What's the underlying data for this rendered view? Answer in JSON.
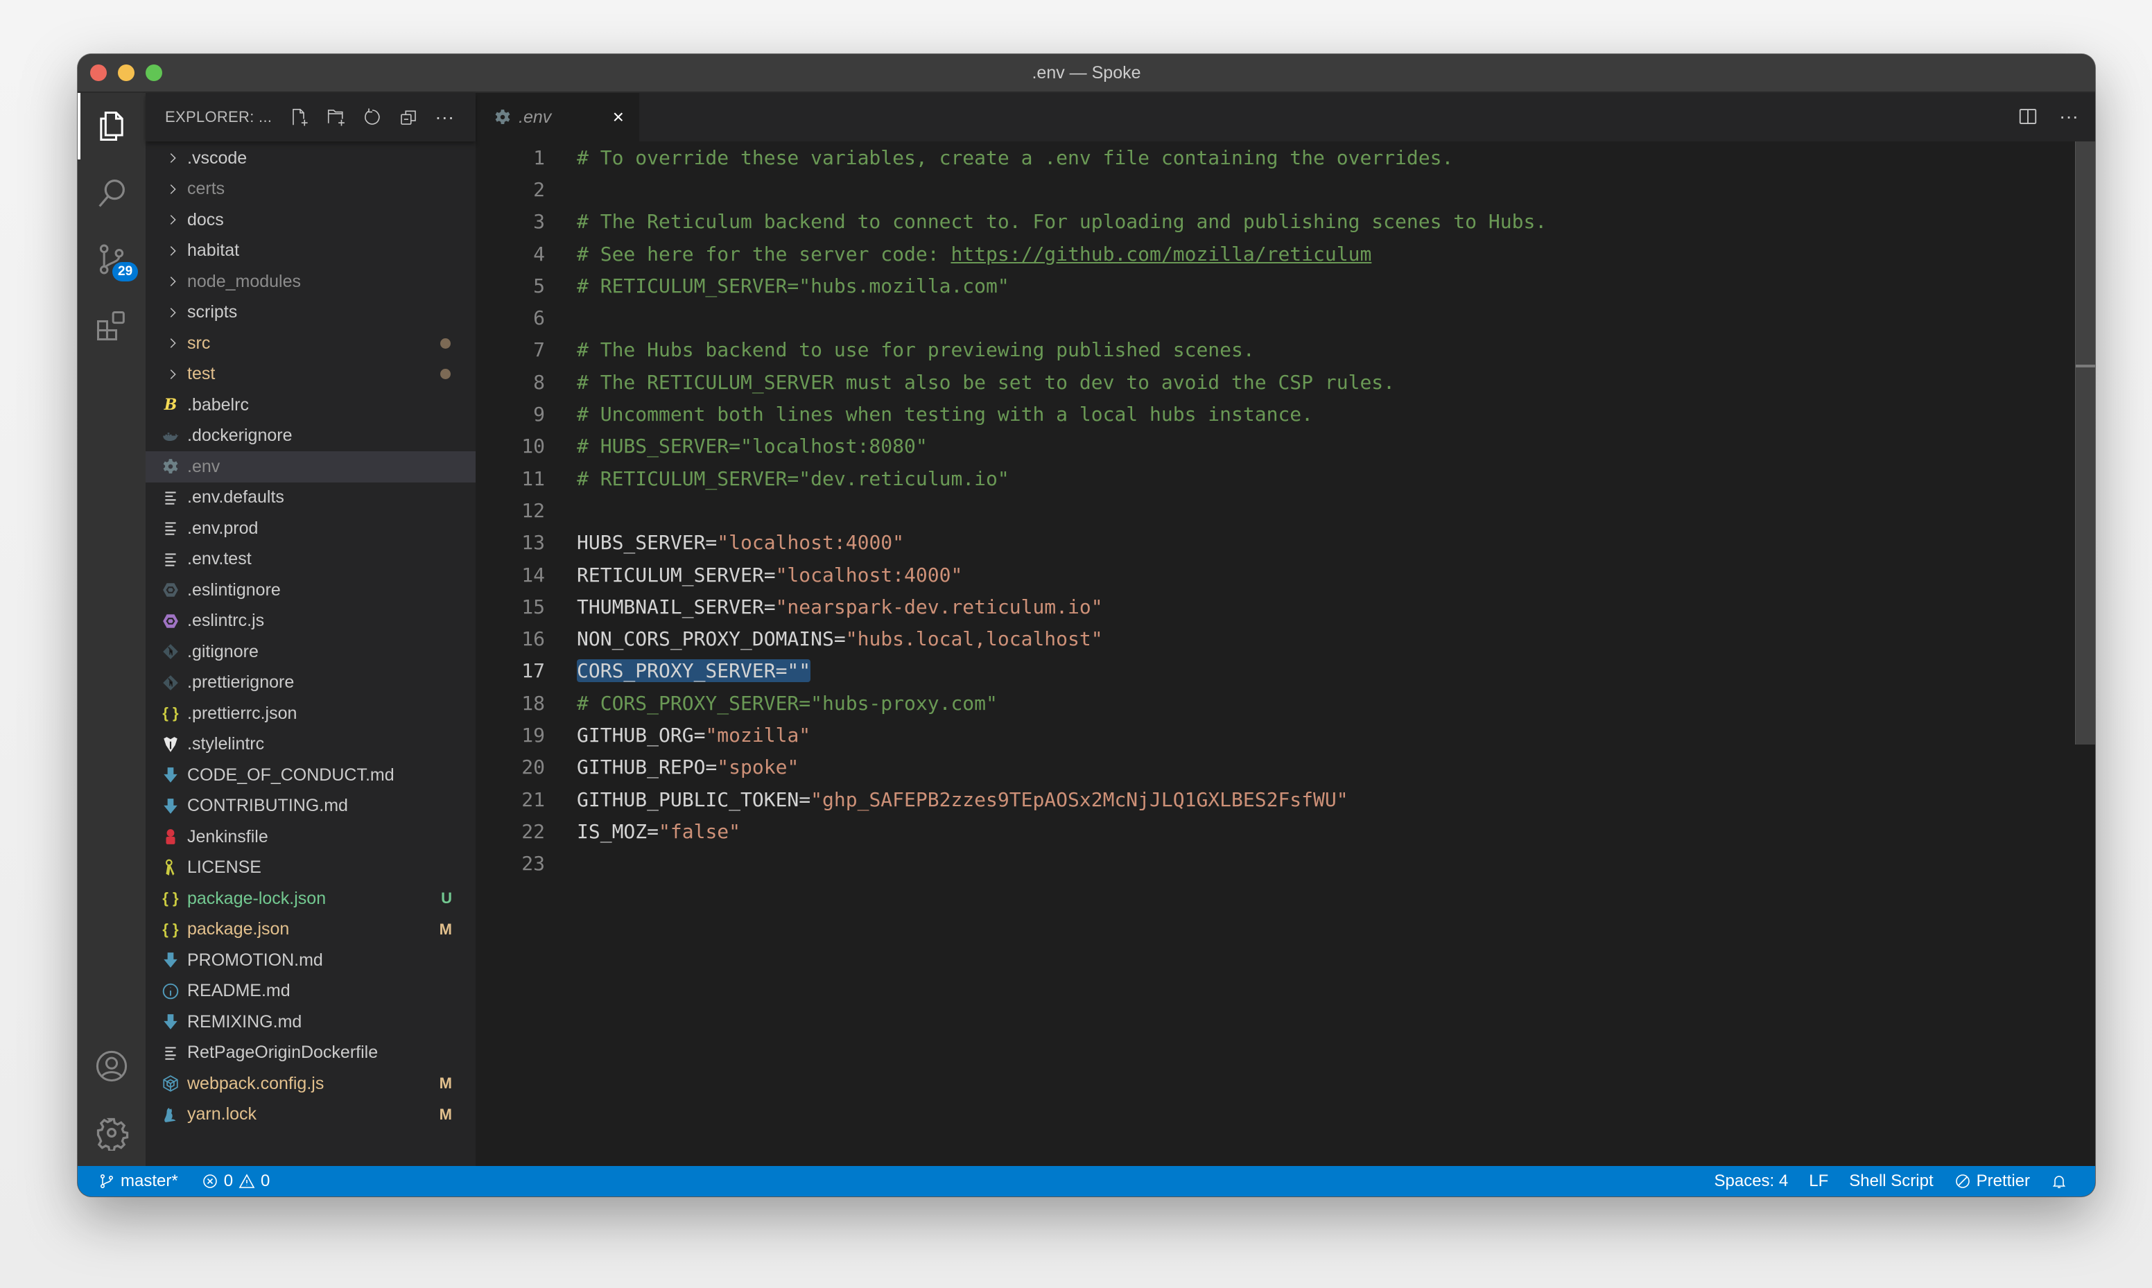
{
  "window": {
    "title": ".env — Spoke"
  },
  "activity_bar": {
    "items": [
      {
        "name": "explorer",
        "icon": "files-icon",
        "active": true
      },
      {
        "name": "search",
        "icon": "search-icon"
      },
      {
        "name": "source-control",
        "icon": "source-control-icon",
        "badge": "29"
      },
      {
        "name": "extensions",
        "icon": "extensions-icon"
      }
    ],
    "bottom": [
      {
        "name": "accounts",
        "icon": "account-icon"
      },
      {
        "name": "manage",
        "icon": "gear-icon"
      }
    ]
  },
  "sidebar": {
    "title": "EXPLORER: ...",
    "actions": [
      "new-file",
      "new-folder",
      "refresh",
      "collapse-all",
      "more"
    ],
    "items": [
      {
        "label": ".vscode",
        "type": "folder"
      },
      {
        "label": "certs",
        "type": "folder",
        "dim": true
      },
      {
        "label": "docs",
        "type": "folder"
      },
      {
        "label": "habitat",
        "type": "folder"
      },
      {
        "label": "node_modules",
        "type": "folder",
        "dim": true
      },
      {
        "label": "scripts",
        "type": "folder"
      },
      {
        "label": "src",
        "type": "folder",
        "status": "modified-dot"
      },
      {
        "label": "test",
        "type": "folder",
        "status": "modified-dot"
      },
      {
        "label": ".babelrc",
        "type": "file",
        "icon": "babel-icon"
      },
      {
        "label": ".dockerignore",
        "type": "file",
        "icon": "docker-icon"
      },
      {
        "label": ".env",
        "type": "file",
        "icon": "gear-file-icon",
        "selected": true,
        "dim": true
      },
      {
        "label": ".env.defaults",
        "type": "file",
        "icon": "text-lines-icon"
      },
      {
        "label": ".env.prod",
        "type": "file",
        "icon": "text-lines-icon"
      },
      {
        "label": ".env.test",
        "type": "file",
        "icon": "text-lines-icon"
      },
      {
        "label": ".eslintignore",
        "type": "file",
        "icon": "eslint-ignore-icon"
      },
      {
        "label": ".eslintrc.js",
        "type": "file",
        "icon": "eslint-icon"
      },
      {
        "label": ".gitignore",
        "type": "file",
        "icon": "git-icon"
      },
      {
        "label": ".prettierignore",
        "type": "file",
        "icon": "git-icon"
      },
      {
        "label": ".prettierrc.json",
        "type": "file",
        "icon": "json-icon"
      },
      {
        "label": ".stylelintrc",
        "type": "file",
        "icon": "stylelint-icon"
      },
      {
        "label": "CODE_OF_CONDUCT.md",
        "type": "file",
        "icon": "markdown-icon"
      },
      {
        "label": "CONTRIBUTING.md",
        "type": "file",
        "icon": "markdown-icon"
      },
      {
        "label": "Jenkinsfile",
        "type": "file",
        "icon": "jenkins-icon"
      },
      {
        "label": "LICENSE",
        "type": "file",
        "icon": "license-icon"
      },
      {
        "label": "package-lock.json",
        "type": "file",
        "icon": "json-icon",
        "git": "U"
      },
      {
        "label": "package.json",
        "type": "file",
        "icon": "json-icon",
        "git": "M"
      },
      {
        "label": "PROMOTION.md",
        "type": "file",
        "icon": "markdown-icon"
      },
      {
        "label": "README.md",
        "type": "file",
        "icon": "info-icon"
      },
      {
        "label": "REMIXING.md",
        "type": "file",
        "icon": "markdown-icon"
      },
      {
        "label": "RetPageOriginDockerfile",
        "type": "file",
        "icon": "text-lines-icon"
      },
      {
        "label": "webpack.config.js",
        "type": "file",
        "icon": "webpack-icon",
        "git": "M"
      },
      {
        "label": "yarn.lock",
        "type": "file",
        "icon": "yarn-icon",
        "git": "M"
      }
    ]
  },
  "editor": {
    "tab": {
      "label": ".env",
      "icon": "gear-file-icon",
      "close": "×"
    },
    "actions": [
      "split-editor",
      "more"
    ],
    "current_line": 17,
    "lines": [
      {
        "n": "1",
        "parts": [
          {
            "t": "# To override these variables, create a .env file containing the overrides.",
            "c": "cm"
          }
        ]
      },
      {
        "n": "2",
        "parts": []
      },
      {
        "n": "3",
        "parts": [
          {
            "t": "# The Reticulum backend to connect to. For uploading and publishing scenes to Hubs.",
            "c": "cm"
          }
        ]
      },
      {
        "n": "4",
        "parts": [
          {
            "t": "# See here for the server code: ",
            "c": "cm"
          },
          {
            "t": "https://github.com/mozilla/reticulum",
            "c": "cm link"
          }
        ]
      },
      {
        "n": "5",
        "parts": [
          {
            "t": "# RETICULUM_SERVER=\"hubs.mozilla.com\"",
            "c": "cm"
          }
        ]
      },
      {
        "n": "6",
        "parts": []
      },
      {
        "n": "7",
        "parts": [
          {
            "t": "# The Hubs backend to use for previewing published scenes.",
            "c": "cm"
          }
        ]
      },
      {
        "n": "8",
        "parts": [
          {
            "t": "# The RETICULUM_SERVER must also be set to dev to avoid the CSP rules.",
            "c": "cm"
          }
        ]
      },
      {
        "n": "9",
        "parts": [
          {
            "t": "# Uncomment both lines when testing with a local hubs instance.",
            "c": "cm"
          }
        ]
      },
      {
        "n": "10",
        "parts": [
          {
            "t": "# HUBS_SERVER=\"localhost:8080\"",
            "c": "cm"
          }
        ]
      },
      {
        "n": "11",
        "parts": [
          {
            "t": "# RETICULUM_SERVER=\"dev.reticulum.io\"",
            "c": "cm"
          }
        ]
      },
      {
        "n": "12",
        "parts": []
      },
      {
        "n": "13",
        "parts": [
          {
            "t": "HUBS_SERVER=",
            "c": ""
          },
          {
            "t": "\"localhost:4000\"",
            "c": "str"
          }
        ]
      },
      {
        "n": "14",
        "parts": [
          {
            "t": "RETICULUM_SERVER=",
            "c": ""
          },
          {
            "t": "\"localhost:4000\"",
            "c": "str"
          }
        ]
      },
      {
        "n": "15",
        "parts": [
          {
            "t": "THUMBNAIL_SERVER=",
            "c": ""
          },
          {
            "t": "\"nearspark-dev.reticulum.io\"",
            "c": "str"
          }
        ]
      },
      {
        "n": "16",
        "parts": [
          {
            "t": "NON_CORS_PROXY_DOMAINS=",
            "c": ""
          },
          {
            "t": "\"hubs.local,localhost\"",
            "c": "str"
          }
        ]
      },
      {
        "n": "17",
        "parts": [
          {
            "t": "CORS_PROXY_SERVER=\"\"",
            "c": "sel"
          }
        ]
      },
      {
        "n": "18",
        "parts": [
          {
            "t": "# CORS_PROXY_SERVER=\"hubs-proxy.com\"",
            "c": "cm"
          }
        ]
      },
      {
        "n": "19",
        "parts": [
          {
            "t": "GITHUB_ORG=",
            "c": ""
          },
          {
            "t": "\"mozilla\"",
            "c": "str"
          }
        ]
      },
      {
        "n": "20",
        "parts": [
          {
            "t": "GITHUB_REPO=",
            "c": ""
          },
          {
            "t": "\"spoke\"",
            "c": "str"
          }
        ]
      },
      {
        "n": "21",
        "parts": [
          {
            "t": "GITHUB_PUBLIC_TOKEN=",
            "c": ""
          },
          {
            "t": "\"ghp_SAFEPB2zzes9TEpAOSx2McNjJLQ1GXLBES2FsfWU\"",
            "c": "str"
          }
        ]
      },
      {
        "n": "22",
        "parts": [
          {
            "t": "IS_MOZ=",
            "c": ""
          },
          {
            "t": "\"false\"",
            "c": "str"
          }
        ]
      },
      {
        "n": "23",
        "parts": []
      }
    ]
  },
  "statusbar": {
    "branch": "master*",
    "errors": "0",
    "warnings": "0",
    "indentation": "Spaces: 4",
    "eol": "LF",
    "language": "Shell Script",
    "formatter": "Prettier",
    "colors": {
      "background": "#007acc"
    }
  }
}
